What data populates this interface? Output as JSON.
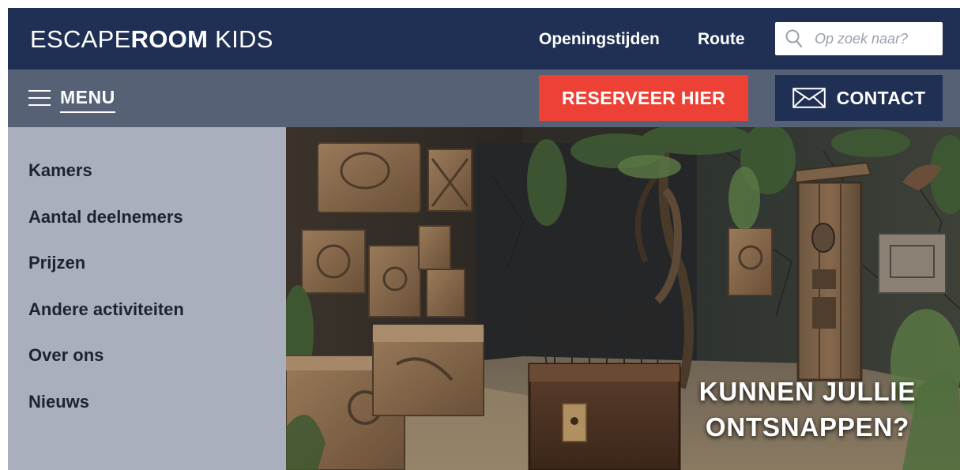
{
  "header": {
    "logo_prefix": "ESCAPE",
    "logo_bold": "ROOM",
    "logo_suffix": " KIDS",
    "links": {
      "hours": "Openingstijden",
      "route": "Route"
    },
    "search": {
      "placeholder": "Op zoek naar?",
      "value": "",
      "icon": "search-icon"
    }
  },
  "nav": {
    "menu_label": "MENU",
    "menu_icon": "hamburger-icon",
    "reserve_label": "RESERVEER HIER",
    "contact_label": "CONTACT",
    "contact_icon": "mail-icon"
  },
  "sidebar": {
    "items": [
      {
        "label": "Kamers"
      },
      {
        "label": "Aantal deelnemers"
      },
      {
        "label": "Prijzen"
      },
      {
        "label": "Andere activiteiten"
      },
      {
        "label": "Over ons"
      },
      {
        "label": "Nieuws"
      }
    ]
  },
  "hero": {
    "line1": "KUNNEN JULLIE",
    "line2": "ONTSNAPPEN?"
  },
  "colors": {
    "header_bg": "#1f3054",
    "nav_bg": "#566176",
    "sidebar_bg": "#a9afbd",
    "reserve_bg": "#ee4136",
    "contact_bg": "#1f3054"
  }
}
